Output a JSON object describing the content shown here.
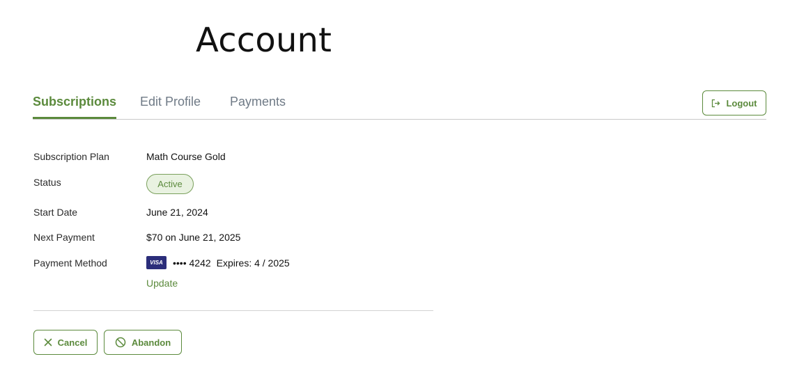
{
  "page": {
    "title": "Account"
  },
  "tabs": [
    {
      "label": "Subscriptions",
      "active": true
    },
    {
      "label": "Edit Profile",
      "active": false
    },
    {
      "label": "Payments",
      "active": false
    }
  ],
  "header": {
    "logout_label": "Logout",
    "logout_icon": "logout-icon"
  },
  "subscription": {
    "plan_label": "Subscription Plan",
    "plan_value": "Math Course Gold",
    "status_label": "Status",
    "status_value": "Active",
    "start_label": "Start Date",
    "start_value": "June 21, 2024",
    "next_label": "Next Payment",
    "next_value": "$70 on June 21, 2025",
    "method_label": "Payment Method",
    "card_brand": "VISA",
    "card_number": "•••• 4242",
    "card_expiry": "Expires: 4 / 2025",
    "update_label": "Update"
  },
  "actions": {
    "cancel_label": "Cancel",
    "cancel_icon": "close-icon",
    "abandon_label": "Abandon",
    "abandon_icon": "prohibit-icon"
  },
  "colors": {
    "accent": "#5b8a3c",
    "badge_bg": "#e9f2e1",
    "visa_bg": "#2b2d7a",
    "tab_inactive": "#6f7a86"
  }
}
